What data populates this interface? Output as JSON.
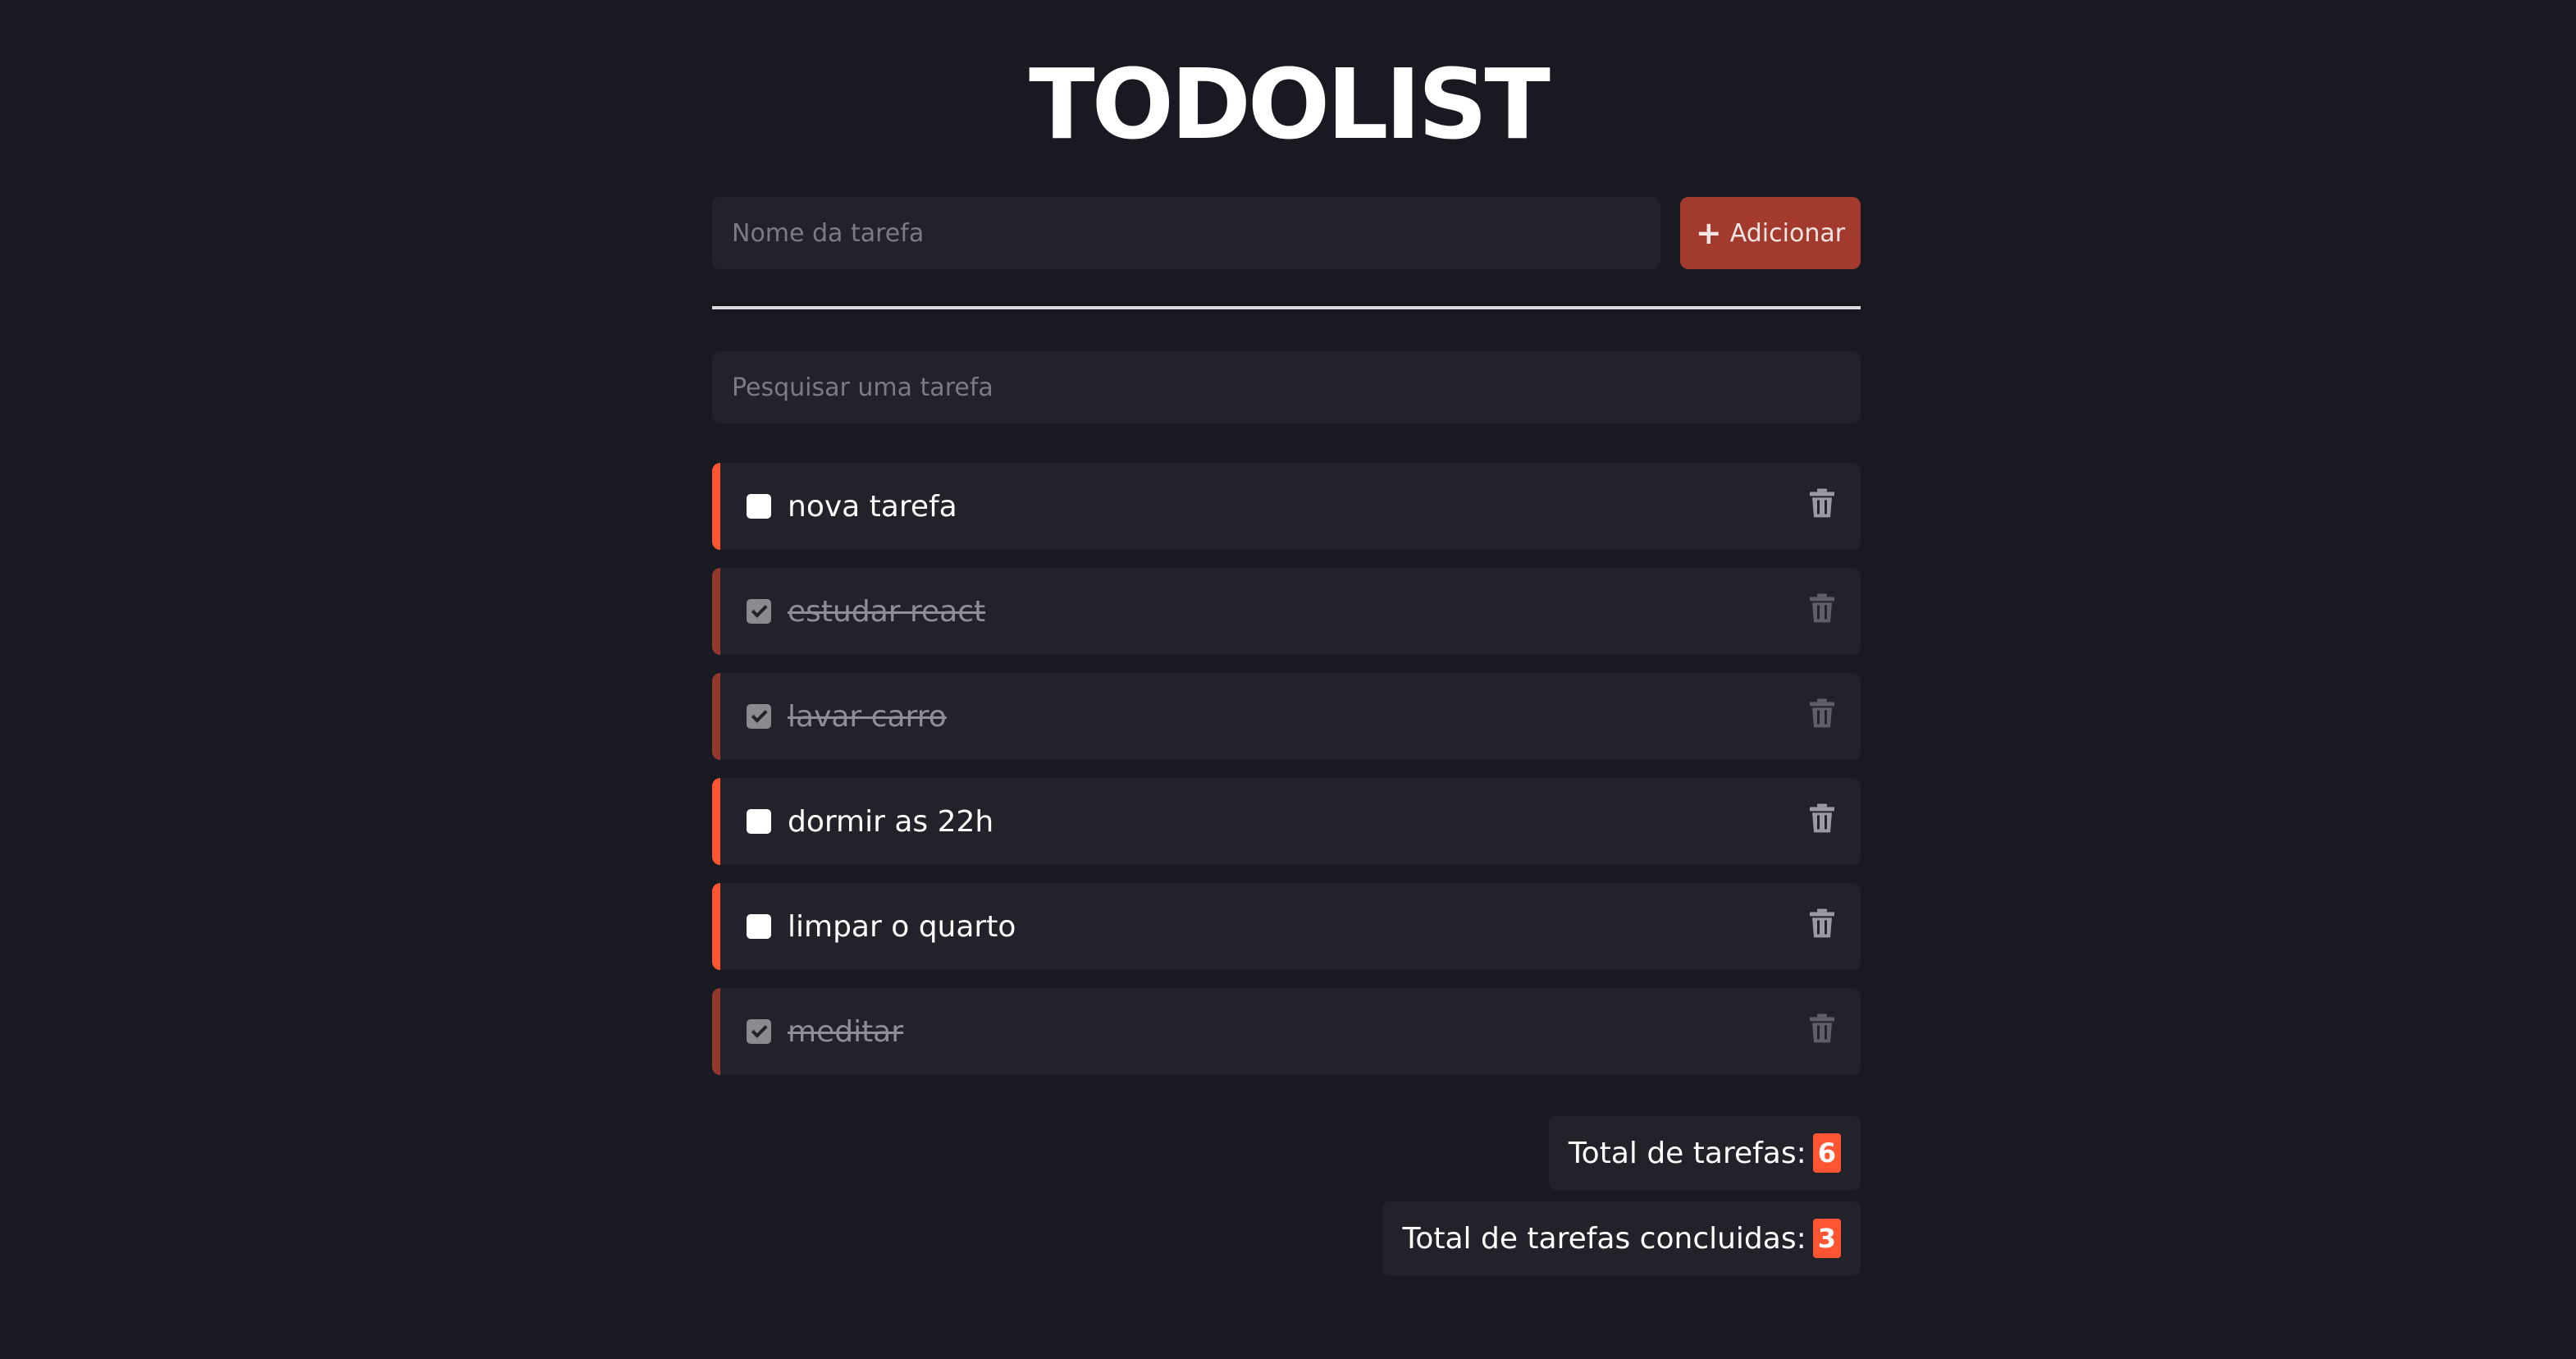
{
  "header": {
    "title": "TODOLIST"
  },
  "form": {
    "task_placeholder": "Nome da tarefa",
    "add_label": "Adicionar",
    "add_icon": "+"
  },
  "search": {
    "placeholder": "Pesquisar uma tarefa"
  },
  "tasks": [
    {
      "label": "nova tarefa",
      "done": false
    },
    {
      "label": "estudar react",
      "done": true
    },
    {
      "label": "lavar carro",
      "done": true
    },
    {
      "label": "dormir as 22h",
      "done": false
    },
    {
      "label": "limpar o quarto",
      "done": false
    },
    {
      "label": "meditar",
      "done": true
    }
  ],
  "totals": {
    "total_label": "Total de tarefas:",
    "total_value": "6",
    "done_label": "Total de tarefas concluidas:",
    "done_value": "3"
  },
  "colors": {
    "background": "#191a21",
    "surface": "#22222b",
    "accent": "#ff5533",
    "accent_done": "#93382c",
    "add_button": "#a23a2e"
  }
}
